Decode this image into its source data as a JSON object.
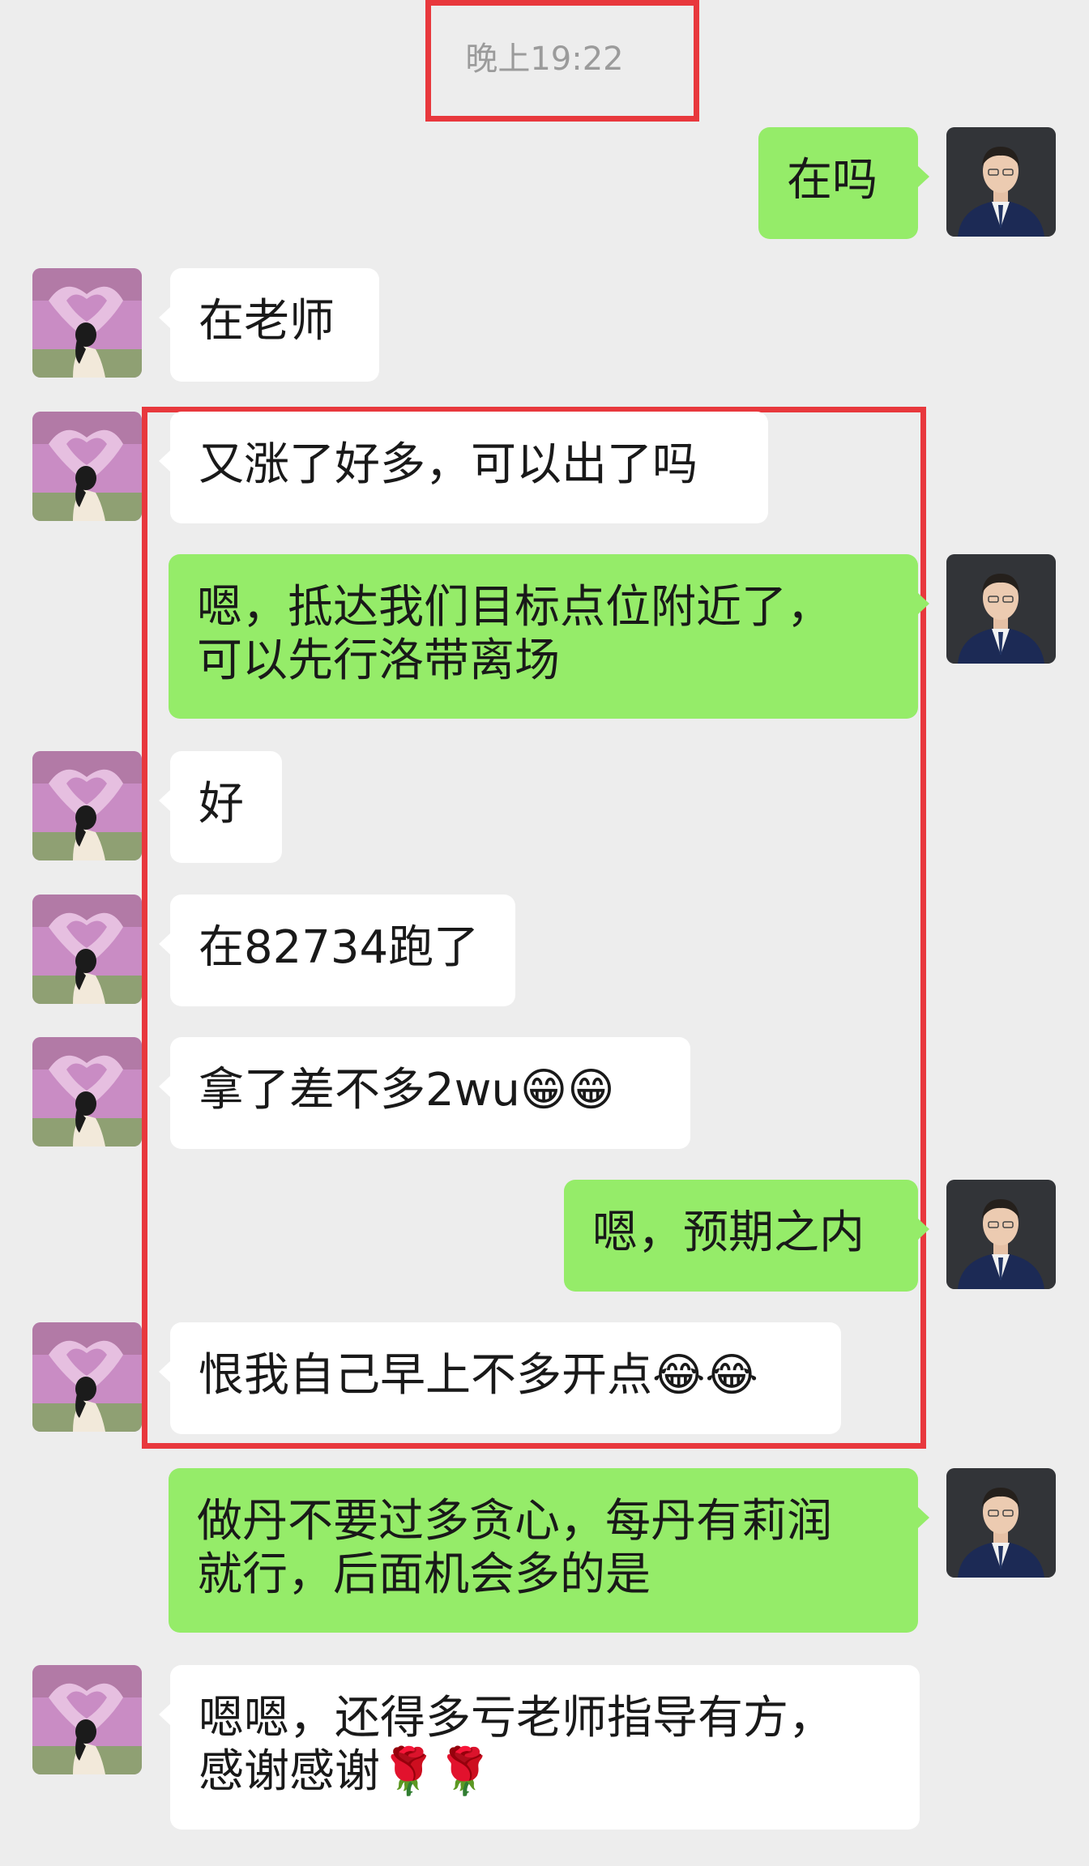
{
  "chat": {
    "timestamp": "晚上19:22",
    "messages": [
      {
        "from": "me",
        "text": "在吗"
      },
      {
        "from": "other",
        "text": "在老师"
      },
      {
        "from": "other",
        "text": "又涨了好多，可以出了吗"
      },
      {
        "from": "me",
        "text": "嗯，抵达我们目标点位附近了，\n可以先行洛带离场"
      },
      {
        "from": "other",
        "text": "好"
      },
      {
        "from": "other",
        "text": "在82734跑了"
      },
      {
        "from": "other",
        "text": "拿了差不多2wu😁😁"
      },
      {
        "from": "me",
        "text": "嗯，预期之内"
      },
      {
        "from": "other",
        "text": "恨我自己早上不多开点😂😂"
      },
      {
        "from": "me",
        "text": "做丹不要过多贪心，每丹有莉润\n就行，后面机会多的是"
      },
      {
        "from": "other",
        "text": "嗯嗯，还得多亏老师指导有方，\n感谢感谢🌹🌹"
      }
    ]
  },
  "colors": {
    "background": "#ededed",
    "outgoing_bubble": "#95ec69",
    "incoming_bubble": "#ffffff",
    "highlight_box": "#e8383d",
    "timestamp_text": "#9b9b9b"
  },
  "icons": {
    "self_avatar": "man-in-suit-avatar",
    "contact_avatar": "woman-in-flower-field-avatar"
  }
}
